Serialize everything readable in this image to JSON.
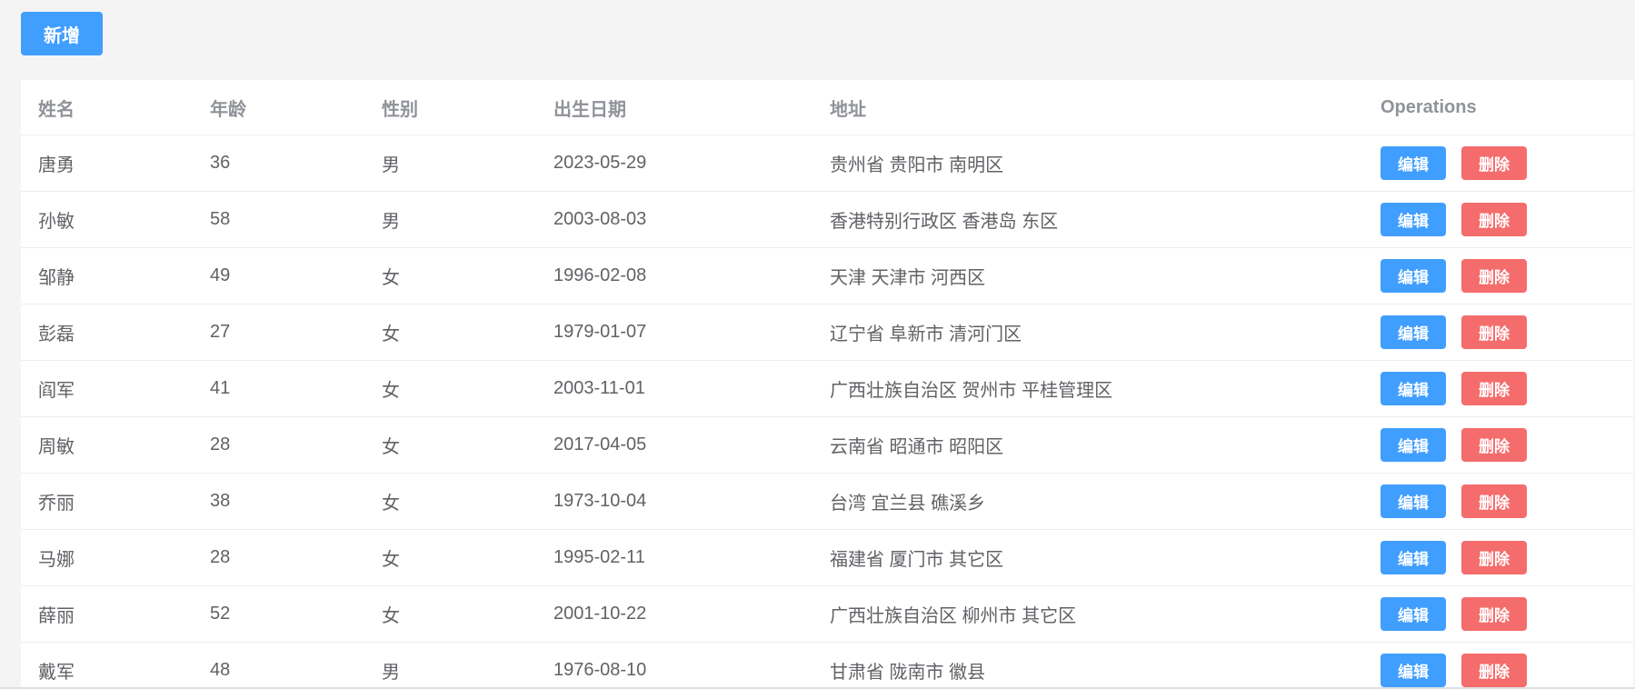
{
  "toolbar": {
    "add_label": "新增"
  },
  "table": {
    "headers": {
      "name": "姓名",
      "age": "年龄",
      "gender": "性别",
      "birth": "出生日期",
      "address": "地址",
      "ops": "Operations"
    },
    "edit_label": "编辑",
    "delete_label": "删除",
    "rows": [
      {
        "name": "唐勇",
        "age": "36",
        "gender": "男",
        "birth": "2023-05-29",
        "address": "贵州省 贵阳市 南明区"
      },
      {
        "name": "孙敏",
        "age": "58",
        "gender": "男",
        "birth": "2003-08-03",
        "address": "香港特别行政区 香港岛 东区"
      },
      {
        "name": "邹静",
        "age": "49",
        "gender": "女",
        "birth": "1996-02-08",
        "address": "天津 天津市 河西区"
      },
      {
        "name": "彭磊",
        "age": "27",
        "gender": "女",
        "birth": "1979-01-07",
        "address": "辽宁省 阜新市 清河门区"
      },
      {
        "name": "阎军",
        "age": "41",
        "gender": "女",
        "birth": "2003-11-01",
        "address": "广西壮族自治区 贺州市 平桂管理区"
      },
      {
        "name": "周敏",
        "age": "28",
        "gender": "女",
        "birth": "2017-04-05",
        "address": "云南省 昭通市 昭阳区"
      },
      {
        "name": "乔丽",
        "age": "38",
        "gender": "女",
        "birth": "1973-10-04",
        "address": "台湾 宜兰县 礁溪乡"
      },
      {
        "name": "马娜",
        "age": "28",
        "gender": "女",
        "birth": "1995-02-11",
        "address": "福建省 厦门市 其它区"
      },
      {
        "name": "薛丽",
        "age": "52",
        "gender": "女",
        "birth": "2001-10-22",
        "address": "广西壮族自治区 柳州市 其它区"
      },
      {
        "name": "戴军",
        "age": "48",
        "gender": "男",
        "birth": "1976-08-10",
        "address": "甘肃省 陇南市 徽县"
      }
    ]
  },
  "colors": {
    "primary": "#409eff",
    "danger": "#f56c6c",
    "header_text": "#909399",
    "body_text": "#606266",
    "page_bg": "#f4f4f4"
  }
}
